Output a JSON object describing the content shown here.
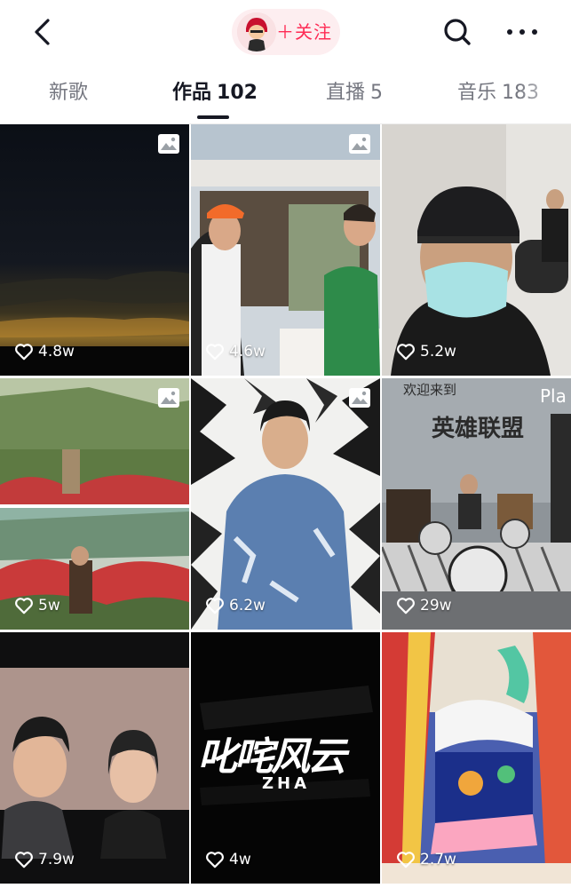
{
  "header": {
    "back_icon": "chevron-left-icon",
    "follow_label": "＋关注",
    "search_icon": "search-icon",
    "more_icon": "more-horizontal-icon"
  },
  "tabs": [
    {
      "label": "新歌",
      "count": "",
      "active": false
    },
    {
      "label": "作品",
      "count": "102",
      "active": true
    },
    {
      "label": "直播",
      "count": "5",
      "active": false
    },
    {
      "label": "音乐",
      "count": "183",
      "active": false
    }
  ],
  "videos": [
    {
      "likes": "4.8w",
      "photo_badge": true,
      "scene": "night sky"
    },
    {
      "likes": "4.6w",
      "photo_badge": true,
      "scene": "men at outdoor restaurant"
    },
    {
      "likes": "5.2w",
      "photo_badge": false,
      "scene": "man in cap and mask"
    },
    {
      "likes": "5w",
      "photo_badge": true,
      "scene": "garden with roses"
    },
    {
      "likes": "6.2w",
      "photo_badge": true,
      "scene": "man in painted denim jacket"
    },
    {
      "likes": "29w",
      "photo_badge": false,
      "scene": "drum kit studio",
      "overlay_text_1": "欢迎来到",
      "overlay_text_2": "英雄联盟",
      "overlay_text_3": "Pla"
    },
    {
      "likes": "7.9w",
      "photo_badge": false,
      "scene": "two people on stage"
    },
    {
      "likes": "4w",
      "photo_badge": false,
      "scene": "calligraphy logo",
      "overlay_text_1": "叱咤风云",
      "overlay_text_2": "ZHA"
    },
    {
      "likes": "2.7w",
      "photo_badge": false,
      "scene": "colorful painting"
    }
  ],
  "colors": {
    "accent": "#fe2c55",
    "follow_bg": "#fdeef0",
    "tab_active": "#161823",
    "tab_inactive": "#757780"
  }
}
